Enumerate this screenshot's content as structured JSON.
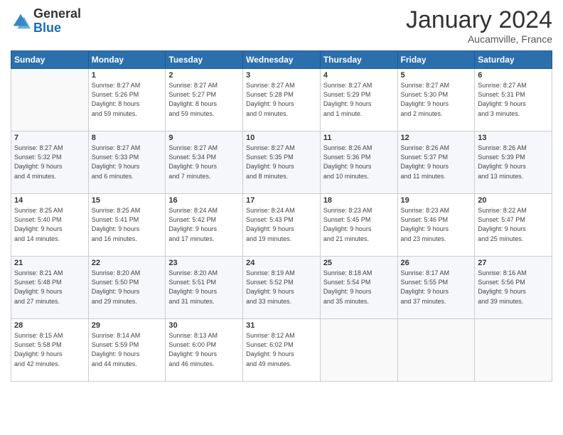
{
  "logo": {
    "general": "General",
    "blue": "Blue"
  },
  "header": {
    "month": "January 2024",
    "location": "Aucamville, France"
  },
  "weekdays": [
    "Sunday",
    "Monday",
    "Tuesday",
    "Wednesday",
    "Thursday",
    "Friday",
    "Saturday"
  ],
  "weeks": [
    [
      {
        "day": "",
        "info": ""
      },
      {
        "day": "1",
        "info": "Sunrise: 8:27 AM\nSunset: 5:26 PM\nDaylight: 8 hours\nand 59 minutes."
      },
      {
        "day": "2",
        "info": "Sunrise: 8:27 AM\nSunset: 5:27 PM\nDaylight: 8 hours\nand 59 minutes."
      },
      {
        "day": "3",
        "info": "Sunrise: 8:27 AM\nSunset: 5:28 PM\nDaylight: 9 hours\nand 0 minutes."
      },
      {
        "day": "4",
        "info": "Sunrise: 8:27 AM\nSunset: 5:29 PM\nDaylight: 9 hours\nand 1 minute."
      },
      {
        "day": "5",
        "info": "Sunrise: 8:27 AM\nSunset: 5:30 PM\nDaylight: 9 hours\nand 2 minutes."
      },
      {
        "day": "6",
        "info": "Sunrise: 8:27 AM\nSunset: 5:31 PM\nDaylight: 9 hours\nand 3 minutes."
      }
    ],
    [
      {
        "day": "7",
        "info": "Sunrise: 8:27 AM\nSunset: 5:32 PM\nDaylight: 9 hours\nand 4 minutes."
      },
      {
        "day": "8",
        "info": "Sunrise: 8:27 AM\nSunset: 5:33 PM\nDaylight: 9 hours\nand 6 minutes."
      },
      {
        "day": "9",
        "info": "Sunrise: 8:27 AM\nSunset: 5:34 PM\nDaylight: 9 hours\nand 7 minutes."
      },
      {
        "day": "10",
        "info": "Sunrise: 8:27 AM\nSunset: 5:35 PM\nDaylight: 9 hours\nand 8 minutes."
      },
      {
        "day": "11",
        "info": "Sunrise: 8:26 AM\nSunset: 5:36 PM\nDaylight: 9 hours\nand 10 minutes."
      },
      {
        "day": "12",
        "info": "Sunrise: 8:26 AM\nSunset: 5:37 PM\nDaylight: 9 hours\nand 11 minutes."
      },
      {
        "day": "13",
        "info": "Sunrise: 8:26 AM\nSunset: 5:39 PM\nDaylight: 9 hours\nand 13 minutes."
      }
    ],
    [
      {
        "day": "14",
        "info": "Sunrise: 8:25 AM\nSunset: 5:40 PM\nDaylight: 9 hours\nand 14 minutes."
      },
      {
        "day": "15",
        "info": "Sunrise: 8:25 AM\nSunset: 5:41 PM\nDaylight: 9 hours\nand 16 minutes."
      },
      {
        "day": "16",
        "info": "Sunrise: 8:24 AM\nSunset: 5:42 PM\nDaylight: 9 hours\nand 17 minutes."
      },
      {
        "day": "17",
        "info": "Sunrise: 8:24 AM\nSunset: 5:43 PM\nDaylight: 9 hours\nand 19 minutes."
      },
      {
        "day": "18",
        "info": "Sunrise: 8:23 AM\nSunset: 5:45 PM\nDaylight: 9 hours\nand 21 minutes."
      },
      {
        "day": "19",
        "info": "Sunrise: 8:23 AM\nSunset: 5:46 PM\nDaylight: 9 hours\nand 23 minutes."
      },
      {
        "day": "20",
        "info": "Sunrise: 8:22 AM\nSunset: 5:47 PM\nDaylight: 9 hours\nand 25 minutes."
      }
    ],
    [
      {
        "day": "21",
        "info": "Sunrise: 8:21 AM\nSunset: 5:48 PM\nDaylight: 9 hours\nand 27 minutes."
      },
      {
        "day": "22",
        "info": "Sunrise: 8:20 AM\nSunset: 5:50 PM\nDaylight: 9 hours\nand 29 minutes."
      },
      {
        "day": "23",
        "info": "Sunrise: 8:20 AM\nSunset: 5:51 PM\nDaylight: 9 hours\nand 31 minutes."
      },
      {
        "day": "24",
        "info": "Sunrise: 8:19 AM\nSunset: 5:52 PM\nDaylight: 9 hours\nand 33 minutes."
      },
      {
        "day": "25",
        "info": "Sunrise: 8:18 AM\nSunset: 5:54 PM\nDaylight: 9 hours\nand 35 minutes."
      },
      {
        "day": "26",
        "info": "Sunrise: 8:17 AM\nSunset: 5:55 PM\nDaylight: 9 hours\nand 37 minutes."
      },
      {
        "day": "27",
        "info": "Sunrise: 8:16 AM\nSunset: 5:56 PM\nDaylight: 9 hours\nand 39 minutes."
      }
    ],
    [
      {
        "day": "28",
        "info": "Sunrise: 8:15 AM\nSunset: 5:58 PM\nDaylight: 9 hours\nand 42 minutes."
      },
      {
        "day": "29",
        "info": "Sunrise: 8:14 AM\nSunset: 5:59 PM\nDaylight: 9 hours\nand 44 minutes."
      },
      {
        "day": "30",
        "info": "Sunrise: 8:13 AM\nSunset: 6:00 PM\nDaylight: 9 hours\nand 46 minutes."
      },
      {
        "day": "31",
        "info": "Sunrise: 8:12 AM\nSunset: 6:02 PM\nDaylight: 9 hours\nand 49 minutes."
      },
      {
        "day": "",
        "info": ""
      },
      {
        "day": "",
        "info": ""
      },
      {
        "day": "",
        "info": ""
      }
    ]
  ]
}
